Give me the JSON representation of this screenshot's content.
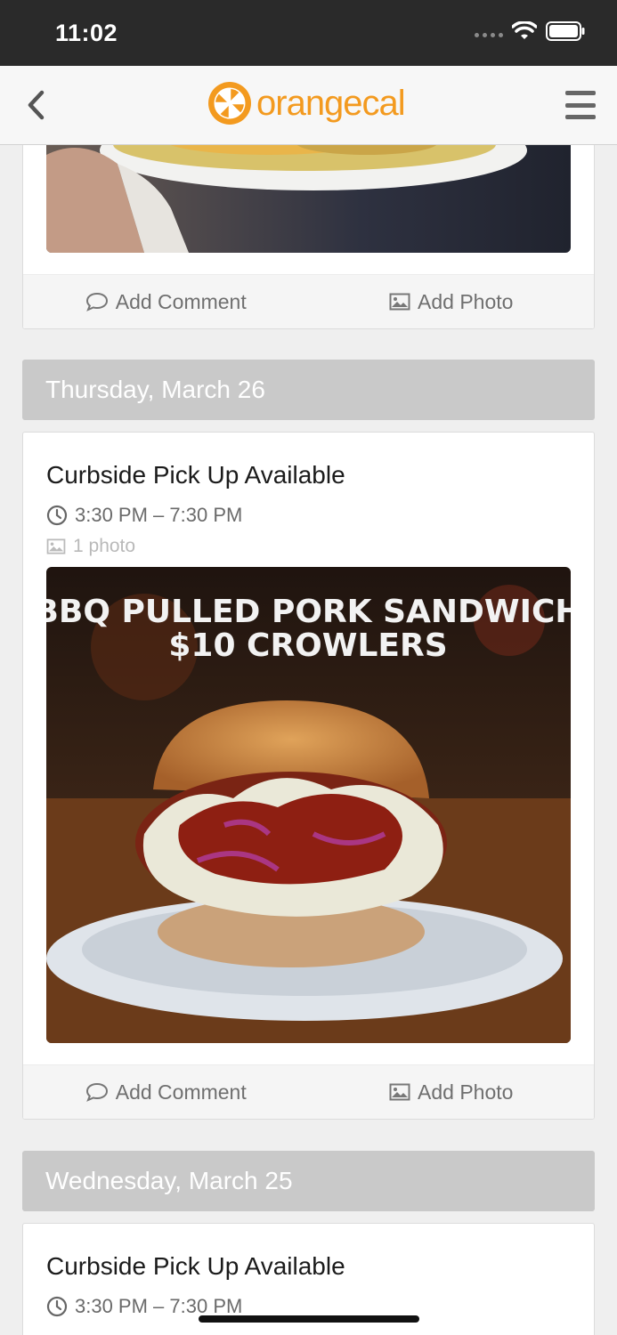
{
  "status": {
    "time": "11:02"
  },
  "nav": {
    "logo_text": "orangecal"
  },
  "actions": {
    "comment": "Add Comment",
    "photo": "Add Photo"
  },
  "sections": [
    {
      "date": "Thursday, March 26",
      "event": {
        "title": "Curbside Pick Up Available",
        "time": "3:30 PM – 7:30 PM",
        "photos": "1 photo",
        "image_lines": [
          "BBQ PULLED PORK SANDWICH",
          "$10 CROWLERS"
        ]
      }
    },
    {
      "date": "Wednesday, March 25",
      "event": {
        "title": "Curbside Pick Up Available",
        "time": "3:30 PM – 7:30 PM"
      }
    }
  ],
  "colors": {
    "brand": "#f39a1f",
    "date_header": "#c9c9c9",
    "status_bar": "#2a2a2a"
  }
}
